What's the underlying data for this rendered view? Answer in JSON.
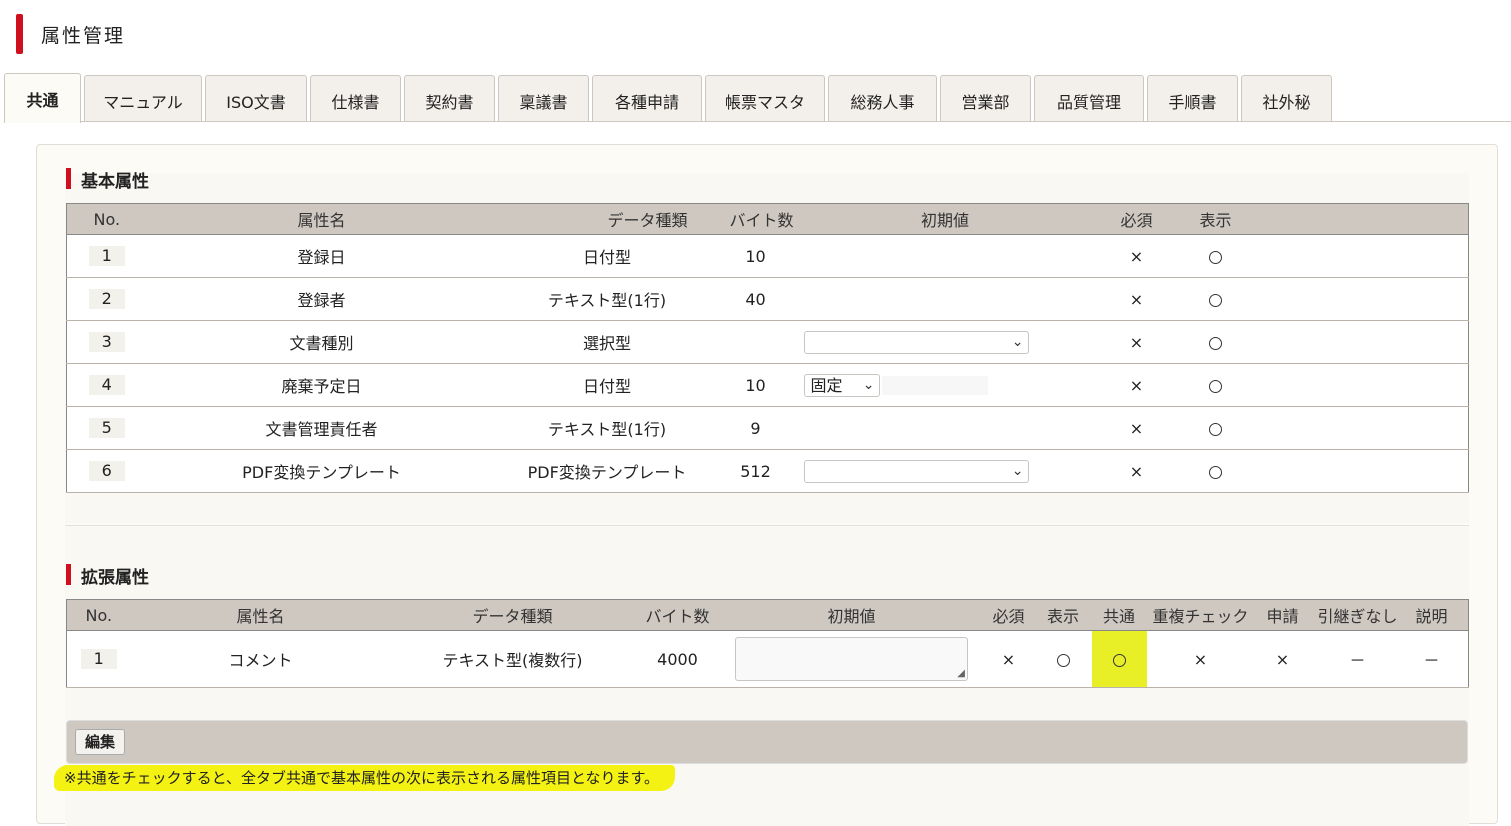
{
  "page": {
    "title": "属性管理"
  },
  "tabs": [
    {
      "label": "共通",
      "active": true
    },
    {
      "label": "マニュアル"
    },
    {
      "label": "ISO文書"
    },
    {
      "label": "仕様書"
    },
    {
      "label": "契約書"
    },
    {
      "label": "稟議書"
    },
    {
      "label": "各種申請"
    },
    {
      "label": "帳票マスタ"
    },
    {
      "label": "総務人事"
    },
    {
      "label": "営業部"
    },
    {
      "label": "品質管理"
    },
    {
      "label": "手順書"
    },
    {
      "label": "社外秘"
    }
  ],
  "basic": {
    "title": "基本属性",
    "headers": [
      "No.",
      "属性名",
      "データ種類",
      "バイト数",
      "初期値",
      "必須",
      "表示"
    ],
    "rows": [
      {
        "no": "1",
        "name": "登録日",
        "type": "日付型",
        "bytes": "10",
        "required": "×"
      },
      {
        "no": "2",
        "name": "登録者",
        "type": "テキスト型(1行)",
        "bytes": "40",
        "required": "×"
      },
      {
        "no": "3",
        "name": "文書種別",
        "type": "選択型",
        "bytes": "",
        "required": "×"
      },
      {
        "no": "4",
        "name": "廃棄予定日",
        "type": "日付型",
        "bytes": "10",
        "required": "×",
        "select_value": "固定"
      },
      {
        "no": "5",
        "name": "文書管理責任者",
        "type": "テキスト型(1行)",
        "bytes": "9",
        "required": "×"
      },
      {
        "no": "6",
        "name": "PDF変換テンプレート",
        "type": "PDF変換テンプレート",
        "bytes": "512",
        "required": "×"
      }
    ]
  },
  "extended": {
    "title": "拡張属性",
    "headers": [
      "No.",
      "属性名",
      "データ種類",
      "バイト数",
      "初期値",
      "必須",
      "表示",
      "共通",
      "重複チェック",
      "申請",
      "引継ぎなし",
      "説明"
    ],
    "rows": [
      {
        "no": "1",
        "name": "コメント",
        "type": "テキスト型(複数行)",
        "bytes": "4000",
        "required": "×",
        "duplicate": "×",
        "apply": "×",
        "no_inherit": "－",
        "desc": "－"
      }
    ]
  },
  "edit_button": "編集",
  "note": "※共通をチェックすると、全タブ共通で基本属性の次に表示される属性項目となります。",
  "colors": {
    "accent": "#d00f1e",
    "header_bg": "#cfc8c1",
    "highlight": "#e9ef27"
  }
}
